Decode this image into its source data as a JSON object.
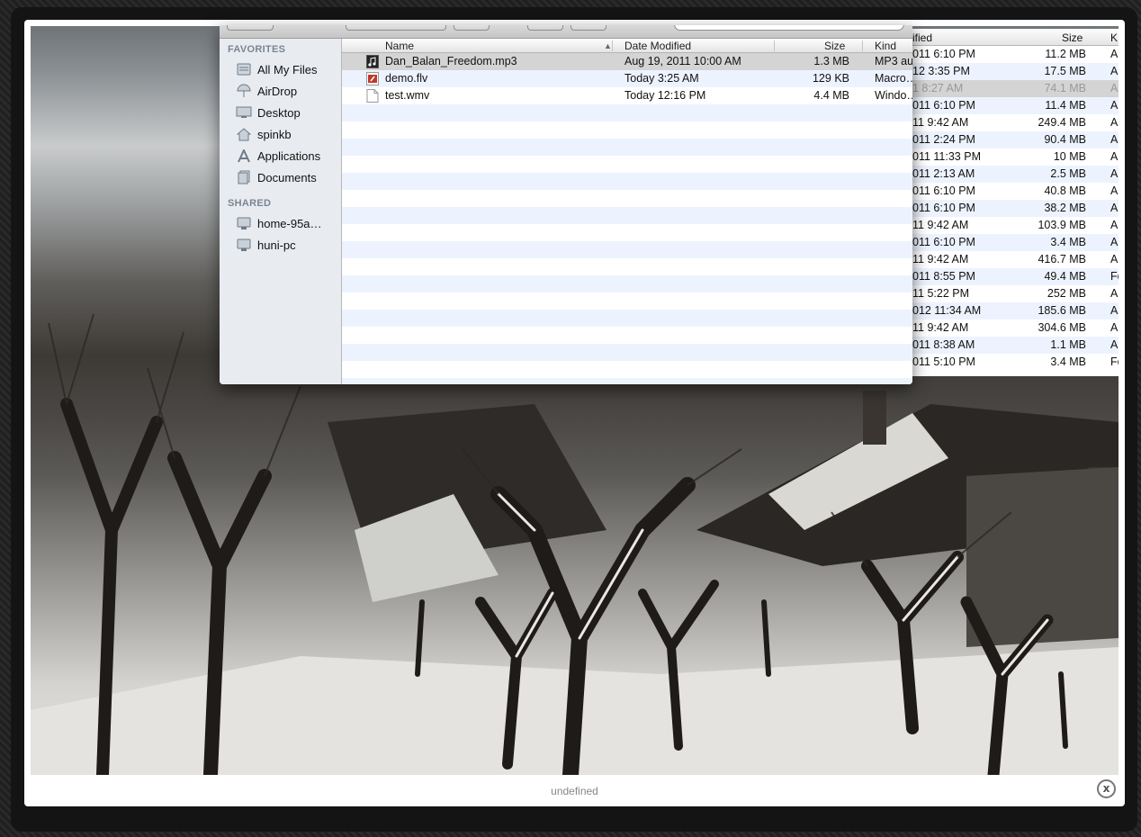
{
  "lightbox": {
    "caption": "undefined",
    "close_label": "x"
  },
  "finder": {
    "sidebar": {
      "favorites_heading": "FAVORITES",
      "favorites": [
        {
          "label": "All My Files",
          "icon": "all-files-icon"
        },
        {
          "label": "AirDrop",
          "icon": "airdrop-icon"
        },
        {
          "label": "Desktop",
          "icon": "desktop-icon"
        },
        {
          "label": "spinkb",
          "icon": "home-icon"
        },
        {
          "label": "Applications",
          "icon": "applications-icon"
        },
        {
          "label": "Documents",
          "icon": "documents-icon"
        }
      ],
      "shared_heading": "SHARED",
      "shared": [
        {
          "label": "home-95a…",
          "icon": "computer-icon"
        },
        {
          "label": "huni-pc",
          "icon": "computer-icon"
        }
      ]
    },
    "columns": {
      "name": "Name",
      "date": "Date Modified",
      "size": "Size",
      "kind": "Kind"
    },
    "files": [
      {
        "name": "Dan_Balan_Freedom.mp3",
        "date": "Aug 19, 2011 10:00 AM",
        "size": "1.3 MB",
        "kind": "MP3 au",
        "icon": "audio-file-icon",
        "selected": true
      },
      {
        "name": "demo.flv",
        "date": "Today 3:25 AM",
        "size": "129 KB",
        "kind": "Macro…",
        "icon": "flash-video-icon",
        "selected": false
      },
      {
        "name": "test.wmv",
        "date": "Today 12:16 PM",
        "size": "4.4 MB",
        "kind": "Windo…",
        "icon": "generic-file-icon",
        "selected": false
      }
    ]
  },
  "background_list": {
    "columns": {
      "date": "ified",
      "size": "Size",
      "kind": "K"
    },
    "rows": [
      {
        "date": "011 6:10 PM",
        "size": "11.2 MB",
        "kind": "A"
      },
      {
        "date": "12 3:35 PM",
        "size": "17.5 MB",
        "kind": "A"
      },
      {
        "date": "1 8:27 AM",
        "size": "74.1 MB",
        "kind": "A",
        "selected": true
      },
      {
        "date": "011 6:10 PM",
        "size": "11.4 MB",
        "kind": "A"
      },
      {
        "date": "11 9:42 AM",
        "size": "249.4 MB",
        "kind": "A"
      },
      {
        "date": "011 2:24 PM",
        "size": "90.4 MB",
        "kind": "A"
      },
      {
        "date": "011 11:33 PM",
        "size": "10 MB",
        "kind": "A"
      },
      {
        "date": "011 2:13 AM",
        "size": "2.5 MB",
        "kind": "A"
      },
      {
        "date": "011 6:10 PM",
        "size": "40.8 MB",
        "kind": "A"
      },
      {
        "date": "011 6:10 PM",
        "size": "38.2 MB",
        "kind": "A"
      },
      {
        "date": "11 9:42 AM",
        "size": "103.9 MB",
        "kind": "A"
      },
      {
        "date": "011 6:10 PM",
        "size": "3.4 MB",
        "kind": "A"
      },
      {
        "date": "11 9:42 AM",
        "size": "416.7 MB",
        "kind": "A"
      },
      {
        "date": "011 8:55 PM",
        "size": "49.4 MB",
        "kind": "Fo"
      },
      {
        "date": "11 5:22 PM",
        "size": "252 MB",
        "kind": "A"
      },
      {
        "date": "012 11:34 AM",
        "size": "185.6 MB",
        "kind": "A"
      },
      {
        "date": "11 9:42 AM",
        "size": "304.6 MB",
        "kind": "A"
      },
      {
        "date": "011 8:38 AM",
        "size": "1.1 MB",
        "kind": "A"
      },
      {
        "date": "011 5:10 PM",
        "size": "3.4 MB",
        "kind": "Fo"
      }
    ]
  }
}
